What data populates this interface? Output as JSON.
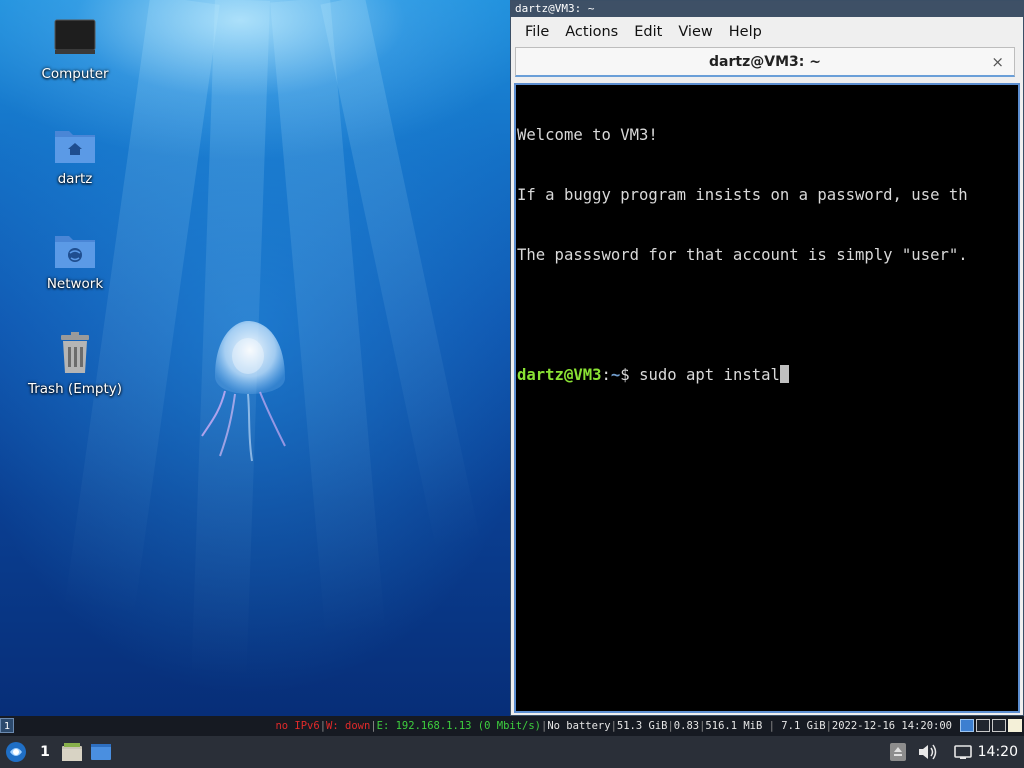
{
  "desktop": {
    "icons": [
      {
        "label": "Computer",
        "icon": "computer-icon"
      },
      {
        "label": "dartz",
        "icon": "home-folder-icon"
      },
      {
        "label": "Network",
        "icon": "network-folder-icon"
      },
      {
        "label": "Trash (Empty)",
        "icon": "trash-icon"
      }
    ]
  },
  "terminal": {
    "window_title": "dartz@VM3: ~",
    "menu": [
      "File",
      "Actions",
      "Edit",
      "View",
      "Help"
    ],
    "tab_title": "dartz@VM3: ~",
    "tab_close": "×",
    "lines": [
      "Welcome to VM3!",
      "If a buggy program insists on a password, use th",
      "The passsword for that account is simply \"user\"."
    ],
    "prompt": {
      "user_host": "dartz@VM3",
      "sep": ":",
      "path": "~",
      "symbol": "$ ",
      "command": "sudo apt instal"
    }
  },
  "statusbar": {
    "workspace": "1",
    "ipv6": "no IPv6",
    "wifi": "W: down",
    "ethernet": "E: 192.168.1.13 (0 Mbit/s)",
    "battery": "No battery",
    "disk": "51.3 GiB",
    "load": "0.83",
    "memory_used": "516.1 MiB",
    "memory_total": "7.1 GiB",
    "datetime": "2022-12-16 14:20:00"
  },
  "taskbar": {
    "workspace_number": "1",
    "clock": "14:20",
    "tray_icons": [
      "removable-drive-icon",
      "volume-icon",
      "network-connection-icon"
    ]
  },
  "colors": {
    "status_red": "#e02a2a",
    "status_green": "#3ecf3e",
    "prompt_user": "#8ae234",
    "prompt_path": "#729fcf",
    "terminal_border": "#5c8ed0"
  }
}
